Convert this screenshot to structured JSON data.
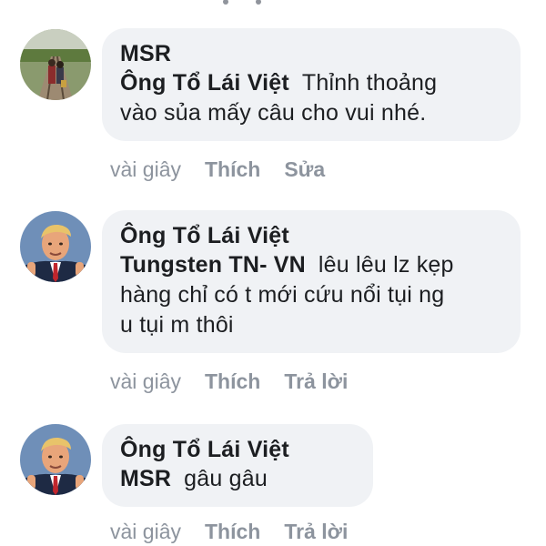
{
  "comments": [
    {
      "author": "MSR",
      "mention": "Ông Tổ Lái Việt",
      "text_line1": "Thỉnh thoảng",
      "text_line2": "vào sủa mấy câu cho vui nhé.",
      "time": "vài giây",
      "like_label": "Thích",
      "second_action": "Sửa",
      "avatar_icon": "railway-couple-photo-icon"
    },
    {
      "author": "Ông Tổ Lái Việt",
      "mention": "Tungsten TN- VN",
      "text_line1": "lêu lêu lz kẹp",
      "text_line2": "hàng chỉ có t mới cứu nổi tụi ng",
      "text_line3": "u tụi m thôi",
      "time": "vài giây",
      "like_label": "Thích",
      "second_action": "Trả lời",
      "avatar_icon": "man-in-suit-portrait-icon"
    },
    {
      "author": "Ông Tổ Lái Việt",
      "mention": "MSR",
      "text_line1": "gâu gâu",
      "time": "vài giây",
      "like_label": "Thích",
      "second_action": "Trả lời",
      "avatar_icon": "man-in-suit-portrait-icon"
    }
  ],
  "colors": {
    "bubble_bg": "#f0f2f5",
    "text": "#1c1e21",
    "meta": "#8d949e"
  }
}
